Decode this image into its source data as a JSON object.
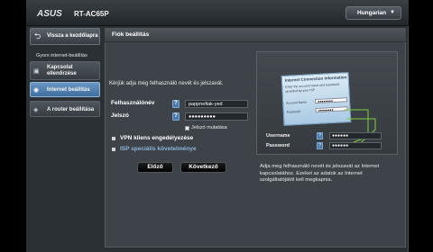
{
  "header": {
    "brand": "ASUS",
    "model": "RT-AC65P",
    "language": "Hungarian"
  },
  "sidebar": {
    "back_label": "Vissza a kezdőlapra",
    "section_label": "Gyors internet-beállítás",
    "steps": [
      {
        "label_line1": "Kapcsolat",
        "label_line2": "ellenőrzése"
      },
      {
        "label_line1": "Internet beállítás",
        "label_line2": ""
      },
      {
        "label_line1": "A router beállítása",
        "label_line2": ""
      }
    ]
  },
  "main": {
    "title": "Fiók beállítás",
    "instruction": "Kérjük adja meg felhasználó nevét és jelszavát.",
    "username_label": "Felhasználónév",
    "username_value": "pappnefiak-yed",
    "password_label": "Jelszó",
    "password_value": "●●●●●●●●●",
    "show_password_label": "Jelszó mutatása",
    "option_vpn": "VPN kliens engedélyezése",
    "option_isp": "ISP speciális követelménye",
    "prev_button": "Előző",
    "next_button": "Következő",
    "help_glyph": "?"
  },
  "illustration": {
    "dialog_title": "Internet Connection Information",
    "dialog_line1": "Enter the account name and password",
    "dialog_line2": "provided by your ISP",
    "dialog_account_label": "Account Name",
    "dialog_password_label": "Password",
    "dialog_input_mask": "●●●●●●●●",
    "username_label": "Username",
    "password_label": "Password",
    "help_glyph": "?",
    "input_mask": "●●●●●●"
  },
  "info_text": "Adja meg felhasználó nevét és jelszavát az Internet kapcsolatához. Ezeket az adatok az Internet szolgáltatójától kell megkapnia.",
  "colors": {
    "accent_blue": "#4a7aa9",
    "active_step": "#5b8cbf",
    "panel": "#3d4348"
  }
}
